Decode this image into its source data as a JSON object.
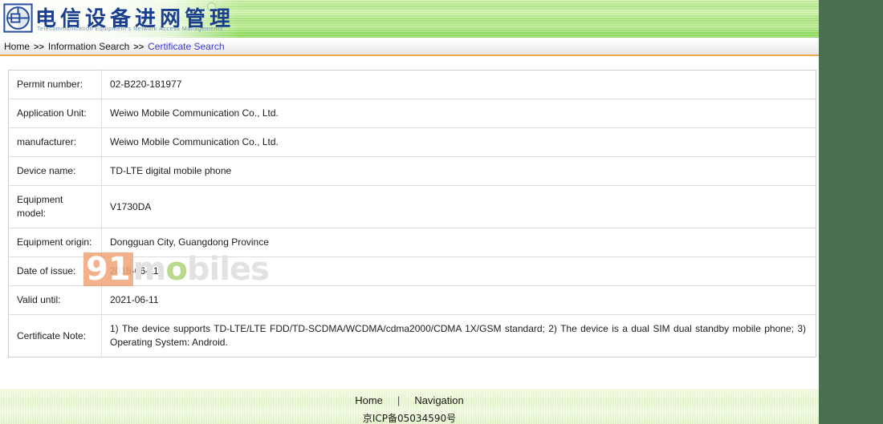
{
  "header": {
    "logo_icon": "telecom-network-access-logo",
    "title_cn": "电信设备进网管理",
    "title_en": "Telecommunication Equipment's Network Access Managements"
  },
  "breadcrumb": {
    "items": [
      {
        "label": "Home",
        "current": false
      },
      {
        "label": "Information Search",
        "current": false
      },
      {
        "label": "Certificate Search",
        "current": true
      }
    ],
    "separator": ">>"
  },
  "certificate": {
    "rows": [
      {
        "label": "Permit number:",
        "value": "02-B220-181977",
        "tall": true
      },
      {
        "label": "Application Unit:",
        "value": "Weiwo Mobile Communication Co., Ltd.",
        "tall": true
      },
      {
        "label": "manufacturer:",
        "value": "Weiwo Mobile Communication Co., Ltd.",
        "tall": false
      },
      {
        "label": "Device name:",
        "value": "TD-LTE digital mobile phone",
        "tall": false
      },
      {
        "label": "Equipment model:",
        "value": "V1730DA",
        "tall": true
      },
      {
        "label": "Equipment origin:",
        "value": "Dongguan City, Guangdong Province",
        "tall": true
      },
      {
        "label": "Date of issue:",
        "value": "2018-06-11",
        "tall": false
      },
      {
        "label": "Valid until:",
        "value": "2021-06-11",
        "tall": false
      },
      {
        "label": "Certificate Note:",
        "value": "1) The device supports TD-LTE/LTE FDD/TD-SCDMA/WCDMA/cdma2000/CDMA 1X/GSM standard; 2) The device is a dual SIM dual standby mobile phone; 3) Operating System: Android.",
        "tall": true
      }
    ]
  },
  "watermark": {
    "badge": "91",
    "word_before": "m",
    "word_o": "o",
    "word_after": "biles"
  },
  "footer": {
    "home_label": "Home",
    "separator": "|",
    "navigation_label": "Navigation",
    "icp": "京ICP备05034590号"
  },
  "colors": {
    "header_green": "#8ed95e",
    "accent_orange": "#f0a74a",
    "link_blue": "#3a3ad0",
    "page_surround": "#4a7050",
    "watermark_orange": "#f2a477"
  }
}
